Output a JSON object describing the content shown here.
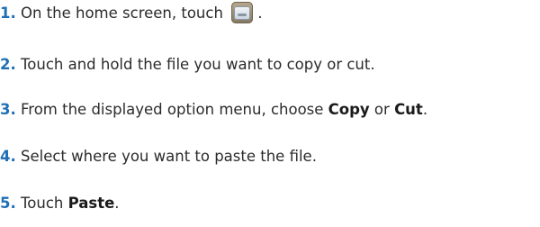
{
  "steps": [
    {
      "number": "1.",
      "text_before": " On the home screen, touch ",
      "text_after": " .",
      "icon": "file-manager-icon"
    },
    {
      "number": "2.",
      "text": " Touch and hold the file you want to copy or cut."
    },
    {
      "number": "3.",
      "text_before": " From the displayed option menu, choose ",
      "bold1": "Copy",
      "middle": " or ",
      "bold2": "Cut",
      "text_after": "."
    },
    {
      "number": "4.",
      "text": " Select where you want to paste the file."
    },
    {
      "number": "5.",
      "text_before": " Touch ",
      "bold1": "Paste",
      "text_after": "."
    }
  ],
  "colors": {
    "step_number": "#1f6fb5",
    "body_text": "#2b2b2b"
  }
}
